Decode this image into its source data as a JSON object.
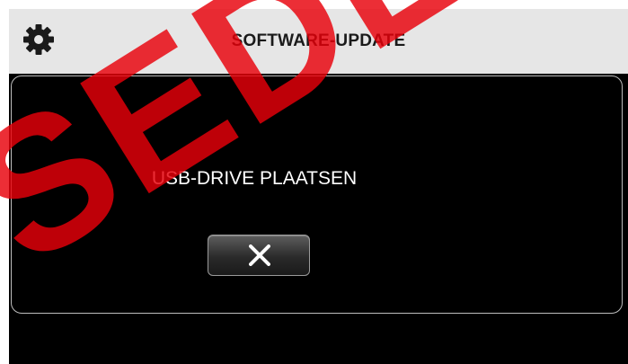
{
  "header": {
    "title": "SOFTWARE-UPDATE",
    "icon": "gear-icon"
  },
  "dialog": {
    "message": "USB-DRIVE PLAATSEN",
    "close_icon": "close-icon"
  },
  "watermark": {
    "text": "SEDL",
    "color": "#e8000a"
  },
  "colors": {
    "titlebar": "#e6e6e6",
    "screen": "#000000",
    "text_light": "#ffffff"
  }
}
